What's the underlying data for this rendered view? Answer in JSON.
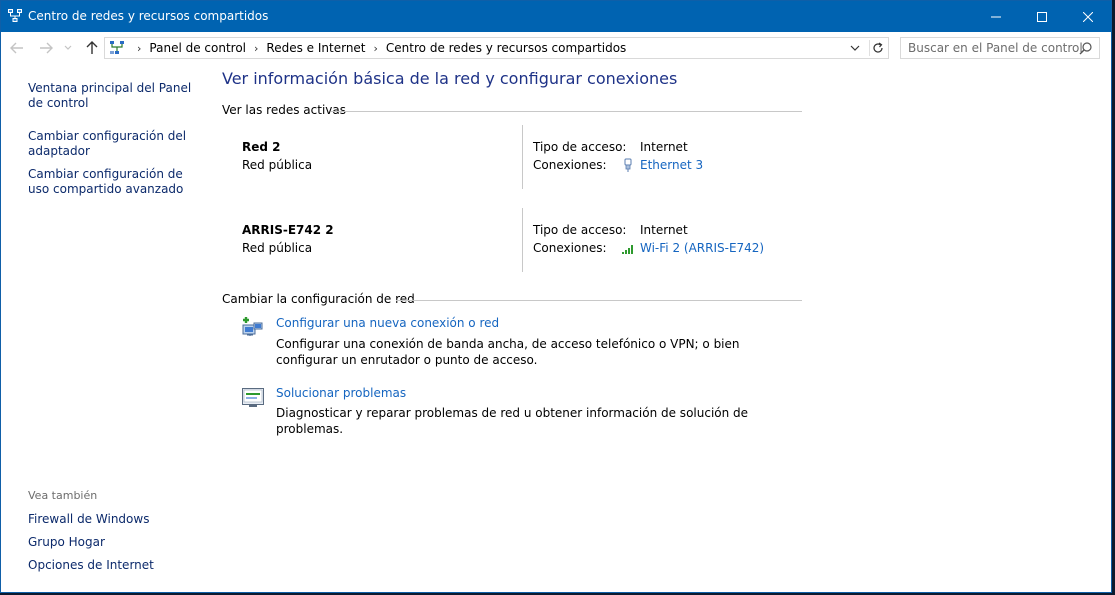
{
  "window": {
    "title": "Centro de redes y recursos compartidos",
    "accent": "#0063b1"
  },
  "address": {
    "crumbs": [
      "Panel de control",
      "Redes e Internet",
      "Centro de redes y recursos compartidos"
    ],
    "search_placeholder": "Buscar en el Panel de control"
  },
  "sidebar": {
    "links": [
      "Ventana principal del Panel de control",
      "Cambiar configuración del adaptador",
      "Cambiar configuración de uso compartido avanzado"
    ],
    "see_also_label": "Vea también",
    "see_also": [
      "Firewall de Windows",
      "Grupo Hogar",
      "Opciones de Internet"
    ]
  },
  "main": {
    "title": "Ver información básica de la red y configurar conexiones",
    "active_networks_label": "Ver las redes activas",
    "networks": [
      {
        "name": "Red  2",
        "type": "Red pública",
        "access_label": "Tipo de acceso:",
        "access_value": "Internet",
        "connections_label": "Conexiones:",
        "connection": "Ethernet 3",
        "connection_icon": "ethernet-icon"
      },
      {
        "name": "ARRIS-E742  2",
        "type": "Red pública",
        "access_label": "Tipo de acceso:",
        "access_value": "Internet",
        "connections_label": "Conexiones:",
        "connection": "Wi-Fi 2 (ARRIS-E742)",
        "connection_icon": "wifi-signal-icon"
      }
    ],
    "change_settings_label": "Cambiar la configuración de red",
    "tasks": [
      {
        "link": "Configurar una nueva conexión o red",
        "description": "Configurar una conexión de banda ancha, de acceso telefónico o VPN; o bien configurar un enrutador o punto de acceso.",
        "icon": "new-connection-icon"
      },
      {
        "link": "Solucionar problemas",
        "description": "Diagnosticar y reparar problemas de red u obtener información de solución de problemas.",
        "icon": "troubleshoot-icon"
      }
    ]
  },
  "colors": {
    "link": "#1565c0",
    "heading": "#1e3287",
    "sidebar_link": "#0c2a6b"
  }
}
